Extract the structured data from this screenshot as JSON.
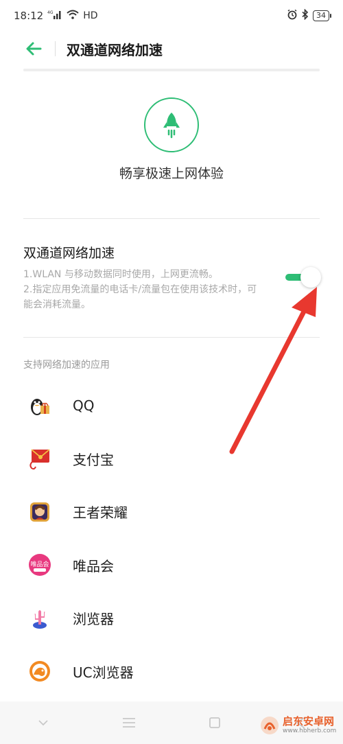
{
  "status_bar": {
    "time": "18:12",
    "network": "4G",
    "hd": "HD",
    "battery": "34"
  },
  "header": {
    "title": "双通道网络加速"
  },
  "hero": {
    "text": "畅享极速上网体验"
  },
  "setting": {
    "title": "双通道网络加速",
    "desc_line1": "1.WLAN 与移动数据同时使用，上网更流畅。",
    "desc_line2": "2.指定应用免流量的电话卡/流量包在使用该技术时，可能会消耗流量。",
    "enabled": true
  },
  "section": {
    "label": "支持网络加速的应用"
  },
  "apps": [
    {
      "name": "QQ"
    },
    {
      "name": "支付宝"
    },
    {
      "name": "王者荣耀"
    },
    {
      "name": "唯品会",
      "icon_text": "唯品会"
    },
    {
      "name": "浏览器"
    },
    {
      "name": "UC浏览器"
    }
  ],
  "watermark": {
    "main": "启东安卓网",
    "sub": "www.hbherb.com"
  },
  "colors": {
    "accent": "#2ebd75",
    "arrow": "#e8382f"
  }
}
